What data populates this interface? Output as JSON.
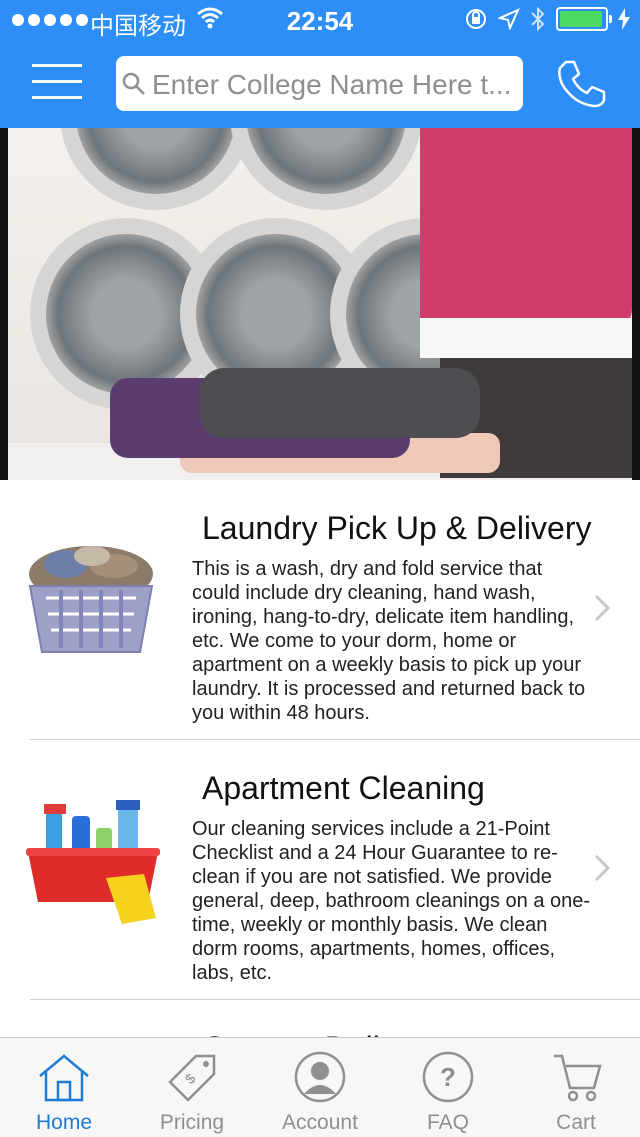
{
  "status_bar": {
    "carrier": "中国移动",
    "time": "22:54"
  },
  "header": {
    "search_placeholder": "Enter College Name Here t...",
    "menu_icon": "hamburger-menu-icon",
    "phone_icon": "phone-icon"
  },
  "services": [
    {
      "title": "Laundry Pick Up & Delivery",
      "description": "This is a wash, dry and fold service that could include dry cleaning, hand wash, ironing, hang-to-dry, delicate item handling, etc. We come to your dorm, home or apartment on a weekly basis to pick up your laundry. It is processed and returned back to you within 48 hours.",
      "icon": "laundry-basket-image"
    },
    {
      "title": "Apartment Cleaning",
      "description": "Our cleaning services include a 21-Point Checklist and a 24 Hour Guarantee to re-clean if you are not satisfied. We provide general, deep, bathroom cleanings on a one-time, weekly or monthly basis. We clean dorm rooms, apartments, homes, offices, labs, etc.",
      "icon": "cleaning-supplies-image"
    },
    {
      "title": "Grocery Deliv",
      "icon": ""
    }
  ],
  "tabs": [
    {
      "label": "Home",
      "icon": "home-icon",
      "active": true
    },
    {
      "label": "Pricing",
      "icon": "price-tag-icon",
      "active": false
    },
    {
      "label": "Account",
      "icon": "account-icon",
      "active": false
    },
    {
      "label": "FAQ",
      "icon": "question-icon",
      "active": false
    },
    {
      "label": "Cart",
      "icon": "cart-icon",
      "active": false
    }
  ],
  "colors": {
    "header_blue": "#2e8ef7",
    "tab_active": "#1f7bd6",
    "tab_inactive": "#8e8e93"
  }
}
